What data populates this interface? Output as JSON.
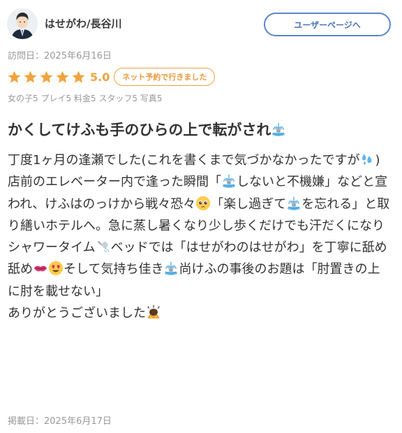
{
  "reviewer": {
    "name": "はせがわ/長谷川",
    "avatar_icon": "male-avatar-icon"
  },
  "header": {
    "user_page_label": "ユーザーページへ",
    "accent_color": "#5b86c8"
  },
  "visit": {
    "date_label": "訪問日：2025年6月16日"
  },
  "rating": {
    "stars": 5,
    "stars_max": 5,
    "score": "5.0",
    "badge": "ネット予約で行きました",
    "star_color": "#f0a23c"
  },
  "sub_ratings": "女の子5 プレイ5 料金5 スタッフ5 写真5",
  "review": {
    "title": "かくしてけふも手のひらの上で転がされ",
    "title_emoji": "fountain-emoji",
    "paragraphs": [
      {
        "segments": [
          {
            "t": "丁度1ヶ月の逢瀬でした(これを書くまで気づかなかったですが"
          },
          {
            "e": "sweat-droplets-emoji"
          },
          {
            "t": ")"
          }
        ]
      },
      {
        "segments": [
          {
            "t": "店前のエレベーター内で逢った瞬間「"
          },
          {
            "e": "fountain-emoji"
          },
          {
            "t": "しないと不機嫌」などと宣われ、けふはのっけから戦々恐々"
          },
          {
            "e": "pleading-face-emoji"
          },
          {
            "t": "「楽し過ぎて"
          },
          {
            "e": "fountain-emoji"
          },
          {
            "t": "を忘れる」と取り繕いホテルへ。急に蒸し暑くなり少し歩くだけでも汗だくになりシャワータイム"
          },
          {
            "e": "shower-emoji"
          },
          {
            "t": "ベッドでは「はせがわのはせがわ」を丁寧に舐め舐め"
          },
          {
            "e": "kiss-mark-emoji"
          },
          {
            "e": "heart-eyes-emoji"
          },
          {
            "t": "そして気持ち佳き"
          },
          {
            "e": "fountain-emoji"
          },
          {
            "t": "尚けふの事後のお題は「肘置きの上に肘を載せない」"
          }
        ]
      },
      {
        "segments": [
          {
            "t": "ありがとうございました"
          },
          {
            "e": "bowing-person-emoji"
          }
        ]
      }
    ]
  },
  "posted": {
    "date_label": "掲載日：2025年6月17日"
  }
}
